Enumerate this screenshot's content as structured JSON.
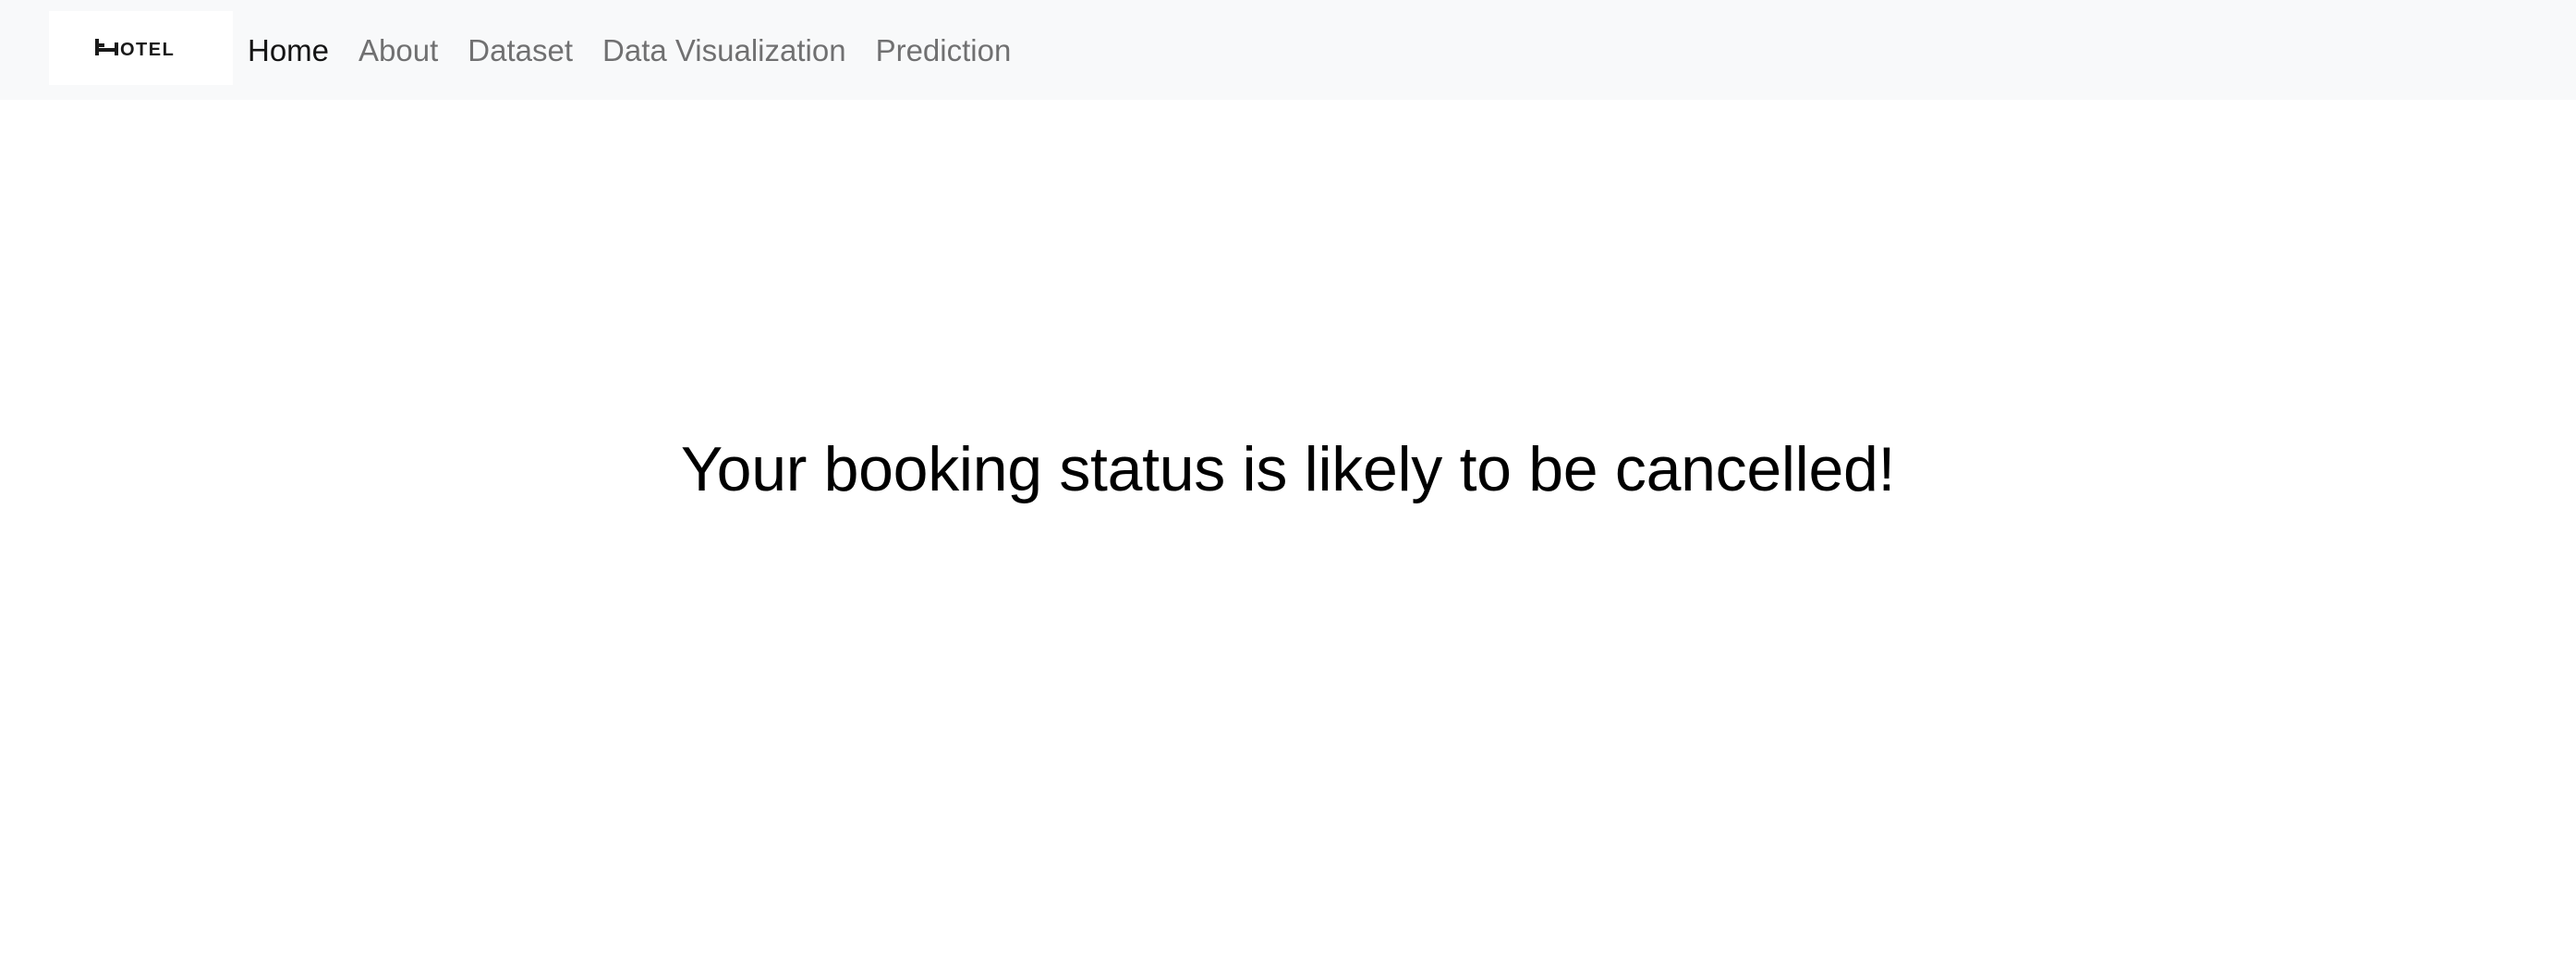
{
  "navbar": {
    "logo": {
      "icon": "bed-icon",
      "text": "HOTEL",
      "letters_after_icon": "OTEL"
    },
    "links": [
      {
        "label": "Home",
        "active": true
      },
      {
        "label": "About",
        "active": false
      },
      {
        "label": "Dataset",
        "active": false
      },
      {
        "label": "Data Visualization",
        "active": false
      },
      {
        "label": "Prediction",
        "active": false
      }
    ]
  },
  "main": {
    "result_message": "Your booking status is likely to be cancelled!"
  },
  "colors": {
    "navbar_bg": "#f8f9fa",
    "active_link": "#000000",
    "inactive_link": "#737373"
  }
}
